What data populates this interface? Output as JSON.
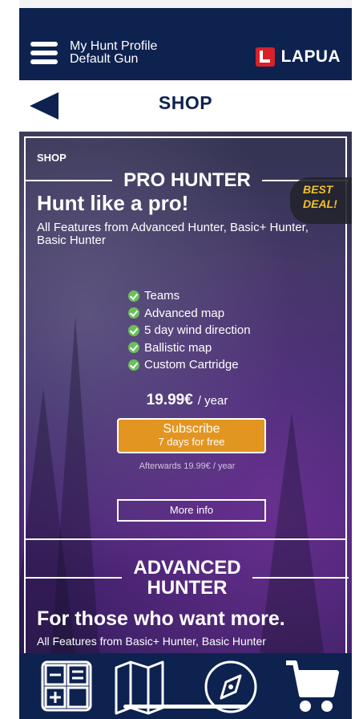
{
  "header": {
    "profile_line1": "My Hunt Profile",
    "profile_line2": "Default Gun",
    "brand": "LAPUA"
  },
  "subheader": {
    "title": "SHOP"
  },
  "shop": {
    "label": "SHOP",
    "plans": [
      {
        "title": "PRO HUNTER",
        "tagline": "Hunt like a pro!",
        "includes": "All Features from Advanced Hunter, Basic+ Hunter, Basic Hunter",
        "badge_line1": "BEST",
        "badge_line2": "DEAL!",
        "features": [
          "Teams",
          "Advanced map",
          "5 day wind direction",
          "Ballistic map",
          "Custom Cartridge"
        ],
        "price": "19.99€",
        "period": "/ year",
        "subscribe_label": "Subscribe",
        "trial_label": "7 days for free",
        "afterwards_text": "Afterwards 19.99€ / year",
        "more_info_label": "More info"
      },
      {
        "title_line1": "ADVANCED",
        "title_line2": "HUNTER",
        "tagline": "For those who want more.",
        "includes": "All Features from Basic+ Hunter, Basic Hunter"
      }
    ]
  },
  "colors": {
    "navy": "#0e2250",
    "accent_orange": "#e39521",
    "brand_red": "#d7212b",
    "badge_yellow": "#f2c22a",
    "check_green": "#6bbf5b"
  },
  "bottom_nav": [
    {
      "icon": "calculator-icon"
    },
    {
      "icon": "map-icon"
    },
    {
      "icon": "compass-icon"
    },
    {
      "icon": "cart-icon"
    }
  ]
}
